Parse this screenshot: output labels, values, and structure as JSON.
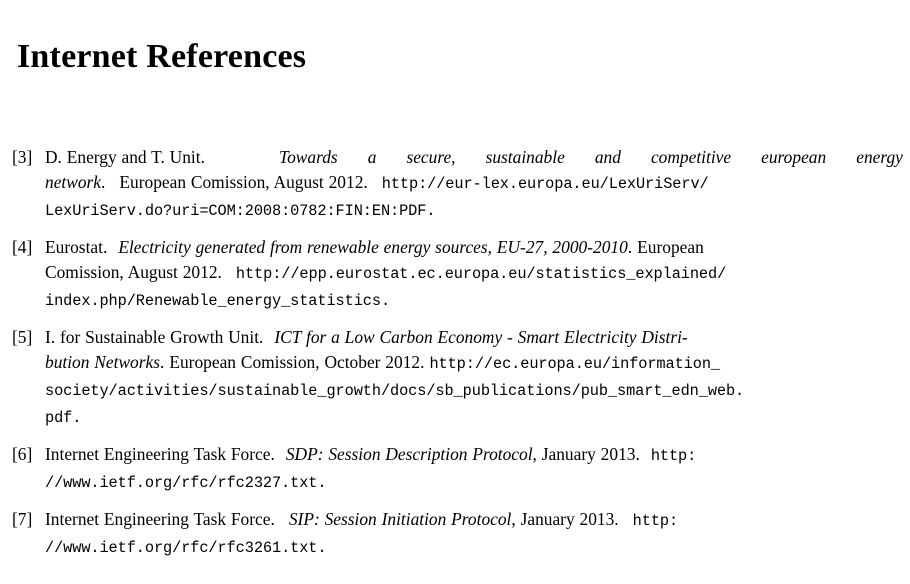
{
  "document": {
    "title": "Internet References"
  },
  "references": [
    {
      "label": "[3]",
      "authors": "D. Energy and T. Unit.",
      "work_title": "Towards a secure, sustainable and competitive european energy network",
      "publisher": "European Comission, August 2012.",
      "url": "http://eur-lex.europa.eu/LexUriServ/LexUriServ.do?uri=COM:2008:0782:FIN:EN:PDF.",
      "lines": [
        {
          "parts": [
            {
              "style": "roman",
              "text": "D. Energy and T. Unit."
            },
            {
              "style": "space-lg",
              "text": " "
            },
            {
              "style": "italic",
              "text": "Towards"
            },
            {
              "style": "gap",
              "text": " "
            },
            {
              "style": "italic",
              "text": "a"
            },
            {
              "style": "gap",
              "text": " "
            },
            {
              "style": "italic",
              "text": "secure,"
            },
            {
              "style": "gap",
              "text": " "
            },
            {
              "style": "italic",
              "text": "sustainable"
            },
            {
              "style": "gap",
              "text": " "
            },
            {
              "style": "italic",
              "text": "and"
            },
            {
              "style": "gap",
              "text": " "
            },
            {
              "style": "italic",
              "text": "competitive"
            },
            {
              "style": "gap",
              "text": " "
            },
            {
              "style": "italic",
              "text": "european"
            },
            {
              "style": "gap",
              "text": " "
            },
            {
              "style": "italic",
              "text": "energy"
            }
          ]
        },
        {
          "parts": [
            {
              "style": "italic",
              "text": "network"
            },
            {
              "style": "roman",
              "text": "."
            },
            {
              "style": "space-lg",
              "text": " "
            },
            {
              "style": "roman",
              "text": "European Comission, August 2012."
            },
            {
              "style": "space-lg",
              "text": " "
            },
            {
              "style": "mono",
              "text": "http://eur-lex.europa.eu/LexUriServ/"
            }
          ]
        },
        {
          "parts": [
            {
              "style": "mono",
              "text": "LexUriServ.do?uri=COM:2008:0782:FIN:EN:PDF."
            }
          ]
        }
      ]
    },
    {
      "label": "[4]",
      "authors": "Eurostat.",
      "work_title": "Electricity generated from renewable energy sources, EU-27, 2000-2010",
      "publisher": "European Comission, August 2012.",
      "url": "http://epp.eurostat.ec.europa.eu/statistics_explained/index.php/Renewable_energy_statistics.",
      "lines": [
        {
          "parts": [
            {
              "style": "roman",
              "text": "Eurostat."
            },
            {
              "style": "space-md",
              "text": " "
            },
            {
              "style": "italic",
              "text": "Electricity generated from renewable energy sources, EU-27, 2000-2010"
            },
            {
              "style": "roman",
              "text": "."
            },
            {
              "style": "space-sm",
              "text": " "
            },
            {
              "style": "roman",
              "text": "European"
            }
          ]
        },
        {
          "parts": [
            {
              "style": "roman",
              "text": "Comission, August 2012."
            },
            {
              "style": "space-lg",
              "text": " "
            },
            {
              "style": "mono",
              "text": "http://epp.eurostat.ec.europa.eu/statistics_explained/"
            }
          ]
        },
        {
          "parts": [
            {
              "style": "mono",
              "text": "index.php/Renewable_energy_statistics."
            }
          ]
        }
      ]
    },
    {
      "label": "[5]",
      "authors": "I. for Sustainable Growth Unit.",
      "work_title": "ICT for a Low Carbon Economy - Smart Electricity Distribution Networks",
      "publisher": "European Comission, October 2012.",
      "url": "http://ec.europa.eu/information_society/activities/sustainable_growth/docs/sb_publications/pub_smart_edn_web.pdf.",
      "lines": [
        {
          "parts": [
            {
              "style": "roman",
              "text": "I. for Sustainable Growth Unit."
            },
            {
              "style": "space-md",
              "text": " "
            },
            {
              "style": "italic",
              "text": "ICT for a Low Carbon Economy - Smart Electricity Distri-"
            }
          ]
        },
        {
          "parts": [
            {
              "style": "italic",
              "text": "bution Networks"
            },
            {
              "style": "roman",
              "text": "."
            },
            {
              "style": "space-sm",
              "text": " "
            },
            {
              "style": "roman",
              "text": "European Comission, October 2012."
            },
            {
              "style": "space-sm",
              "text": " "
            },
            {
              "style": "mono",
              "text": "http://ec.europa.eu/information_"
            }
          ]
        },
        {
          "parts": [
            {
              "style": "mono",
              "text": "society/activities/sustainable_growth/docs/sb_publications/pub_smart_edn_web."
            }
          ]
        },
        {
          "parts": [
            {
              "style": "mono",
              "text": "pdf."
            }
          ]
        }
      ]
    },
    {
      "label": "[6]",
      "authors": "Internet Engineering Task Force.",
      "work_title": "SDP: Session Description Protocol",
      "publisher": "January 2013.",
      "url": "http://www.ietf.org/rfc/rfc2327.txt.",
      "lines": [
        {
          "parts": [
            {
              "style": "roman",
              "text": "Internet Engineering Task Force."
            },
            {
              "style": "space-md",
              "text": " "
            },
            {
              "style": "italic",
              "text": "SDP: Session Description Protocol"
            },
            {
              "style": "roman",
              "text": ", January 2013."
            },
            {
              "style": "space-md",
              "text": " "
            },
            {
              "style": "mono",
              "text": "http:"
            }
          ]
        },
        {
          "parts": [
            {
              "style": "mono",
              "text": "//www.ietf.org/rfc/rfc2327.txt."
            }
          ]
        }
      ]
    },
    {
      "label": "[7]",
      "authors": "Internet Engineering Task Force.",
      "work_title": "SIP: Session Initiation Protocol",
      "publisher": "January 2013.",
      "url": "http://www.ietf.org/rfc/rfc3261.txt.",
      "lines": [
        {
          "parts": [
            {
              "style": "roman",
              "text": "Internet Engineering Task Force."
            },
            {
              "style": "space-lg",
              "text": " "
            },
            {
              "style": "italic",
              "text": "SIP: Session Initiation Protocol"
            },
            {
              "style": "roman",
              "text": ", January 2013."
            },
            {
              "style": "space-lg",
              "text": " "
            },
            {
              "style": "mono",
              "text": "http:"
            }
          ]
        },
        {
          "parts": [
            {
              "style": "mono",
              "text": "//www.ietf.org/rfc/rfc3261.txt."
            }
          ]
        }
      ]
    }
  ]
}
